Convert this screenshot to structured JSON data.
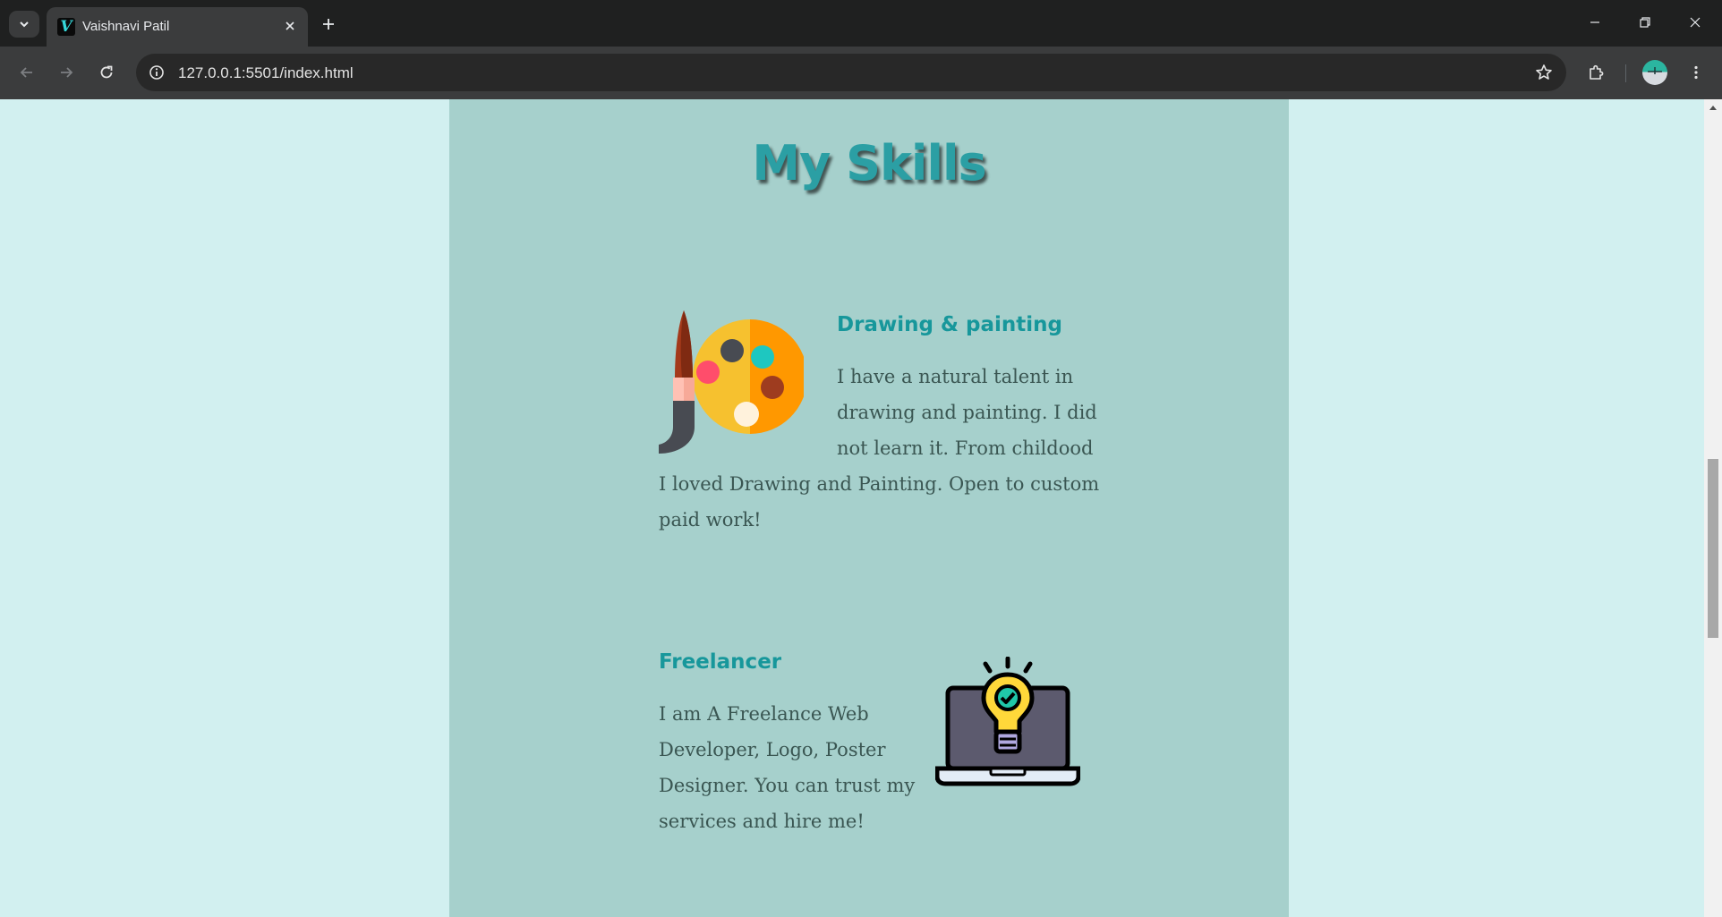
{
  "browser": {
    "tab_title": "Vaishnavi Patil",
    "favicon_letter": "V",
    "url": "127.0.0.1:5501/index.html"
  },
  "icons": {
    "tab_search": "chevron-down-icon",
    "tab_close": "close-icon",
    "new_tab": "plus-icon",
    "back": "arrow-left-icon",
    "forward": "arrow-right-icon",
    "reload": "reload-icon",
    "site_info": "info-icon",
    "bookmark": "star-icon",
    "extensions": "puzzle-icon",
    "menu": "kebab-icon"
  },
  "page": {
    "section_title": "My Skills",
    "skills": [
      {
        "heading": "Drawing & painting",
        "lines": [
          "I have a natural talent in",
          "drawing and painting. I did",
          "not learn it. From childood",
          "I loved Drawing and Painting. Open to custom",
          "paid work!"
        ],
        "icon": "palette-icon"
      },
      {
        "heading": "Freelancer",
        "lines": [
          "I am A Freelance Web",
          "Developer, Logo, Poster",
          "Designer. You can trust my",
          "services and hire me!"
        ],
        "icon": "laptop-lightbulb-icon"
      }
    ]
  },
  "colors": {
    "page_bg": "#d2f0f0",
    "panel_bg": "#a6d0cc",
    "accent": "#17979b",
    "text": "#3a5652"
  }
}
